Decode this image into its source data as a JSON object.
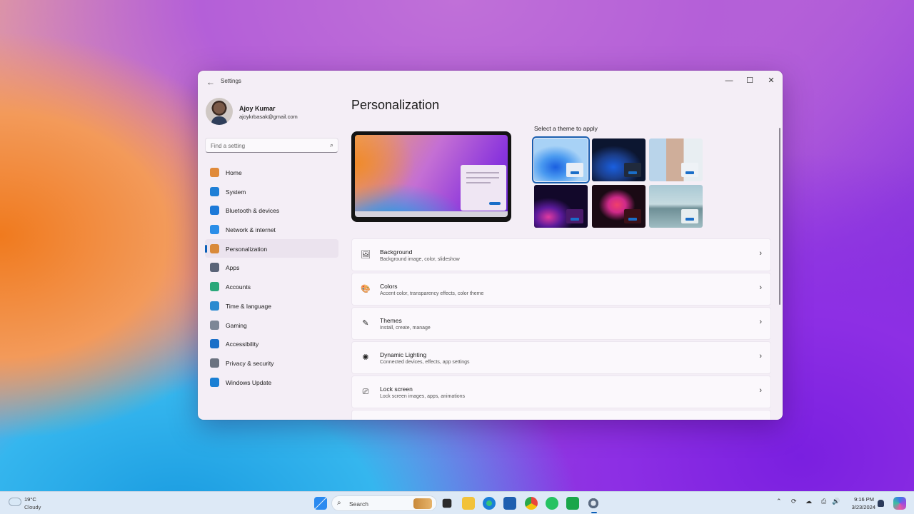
{
  "window": {
    "title": "Settings",
    "back_icon": "←",
    "minimize_icon": "—",
    "maximize_icon": "☐",
    "close_icon": "✕"
  },
  "user": {
    "name": "Ajoy Kumar",
    "email": "ajoykrbasak@gmail.com"
  },
  "search": {
    "placeholder": "Find a setting",
    "icon": "⌕"
  },
  "nav": [
    {
      "label": "Home",
      "icon": "home-icon",
      "color": "#e08a3a"
    },
    {
      "label": "System",
      "icon": "system-icon",
      "color": "#1f7fd6"
    },
    {
      "label": "Bluetooth & devices",
      "icon": "bluetooth-icon",
      "color": "#1d79d8"
    },
    {
      "label": "Network & internet",
      "icon": "wifi-icon",
      "color": "#2b8ee8"
    },
    {
      "label": "Personalization",
      "icon": "brush-icon",
      "color": "#d98a3a",
      "active": true
    },
    {
      "label": "Apps",
      "icon": "apps-icon",
      "color": "#5a6478"
    },
    {
      "label": "Accounts",
      "icon": "accounts-icon",
      "color": "#2aa87a"
    },
    {
      "label": "Time & language",
      "icon": "globe-icon",
      "color": "#2a8ad0"
    },
    {
      "label": "Gaming",
      "icon": "gamepad-icon",
      "color": "#7d8796"
    },
    {
      "label": "Accessibility",
      "icon": "accessibility-icon",
      "color": "#1a6fc8"
    },
    {
      "label": "Privacy & security",
      "icon": "shield-icon",
      "color": "#6b7280"
    },
    {
      "label": "Windows Update",
      "icon": "update-icon",
      "color": "#1a7fd4"
    }
  ],
  "page": {
    "title": "Personalization",
    "themes_label": "Select a theme to apply"
  },
  "rows": [
    {
      "title": "Background",
      "subtitle": "Background image, color, slideshow",
      "icon": "🖼"
    },
    {
      "title": "Colors",
      "subtitle": "Accent color, transparency effects, color theme",
      "icon": "🎨"
    },
    {
      "title": "Themes",
      "subtitle": "Install, create, manage",
      "icon": "✎"
    },
    {
      "title": "Dynamic Lighting",
      "subtitle": "Connected devices, effects, app settings",
      "icon": "✺"
    },
    {
      "title": "Lock screen",
      "subtitle": "Lock screen images, apps, animations",
      "icon": "⎚"
    }
  ],
  "chevron": "›",
  "taskbar": {
    "temperature": "19°C",
    "condition": "Cloudy",
    "search_label": "Search",
    "search_icon": "⌕",
    "time": "9:16 PM",
    "date": "3/23/2024",
    "tray_icons": [
      "⌃",
      "⟳",
      "☁",
      "⎙",
      "🔊"
    ]
  }
}
